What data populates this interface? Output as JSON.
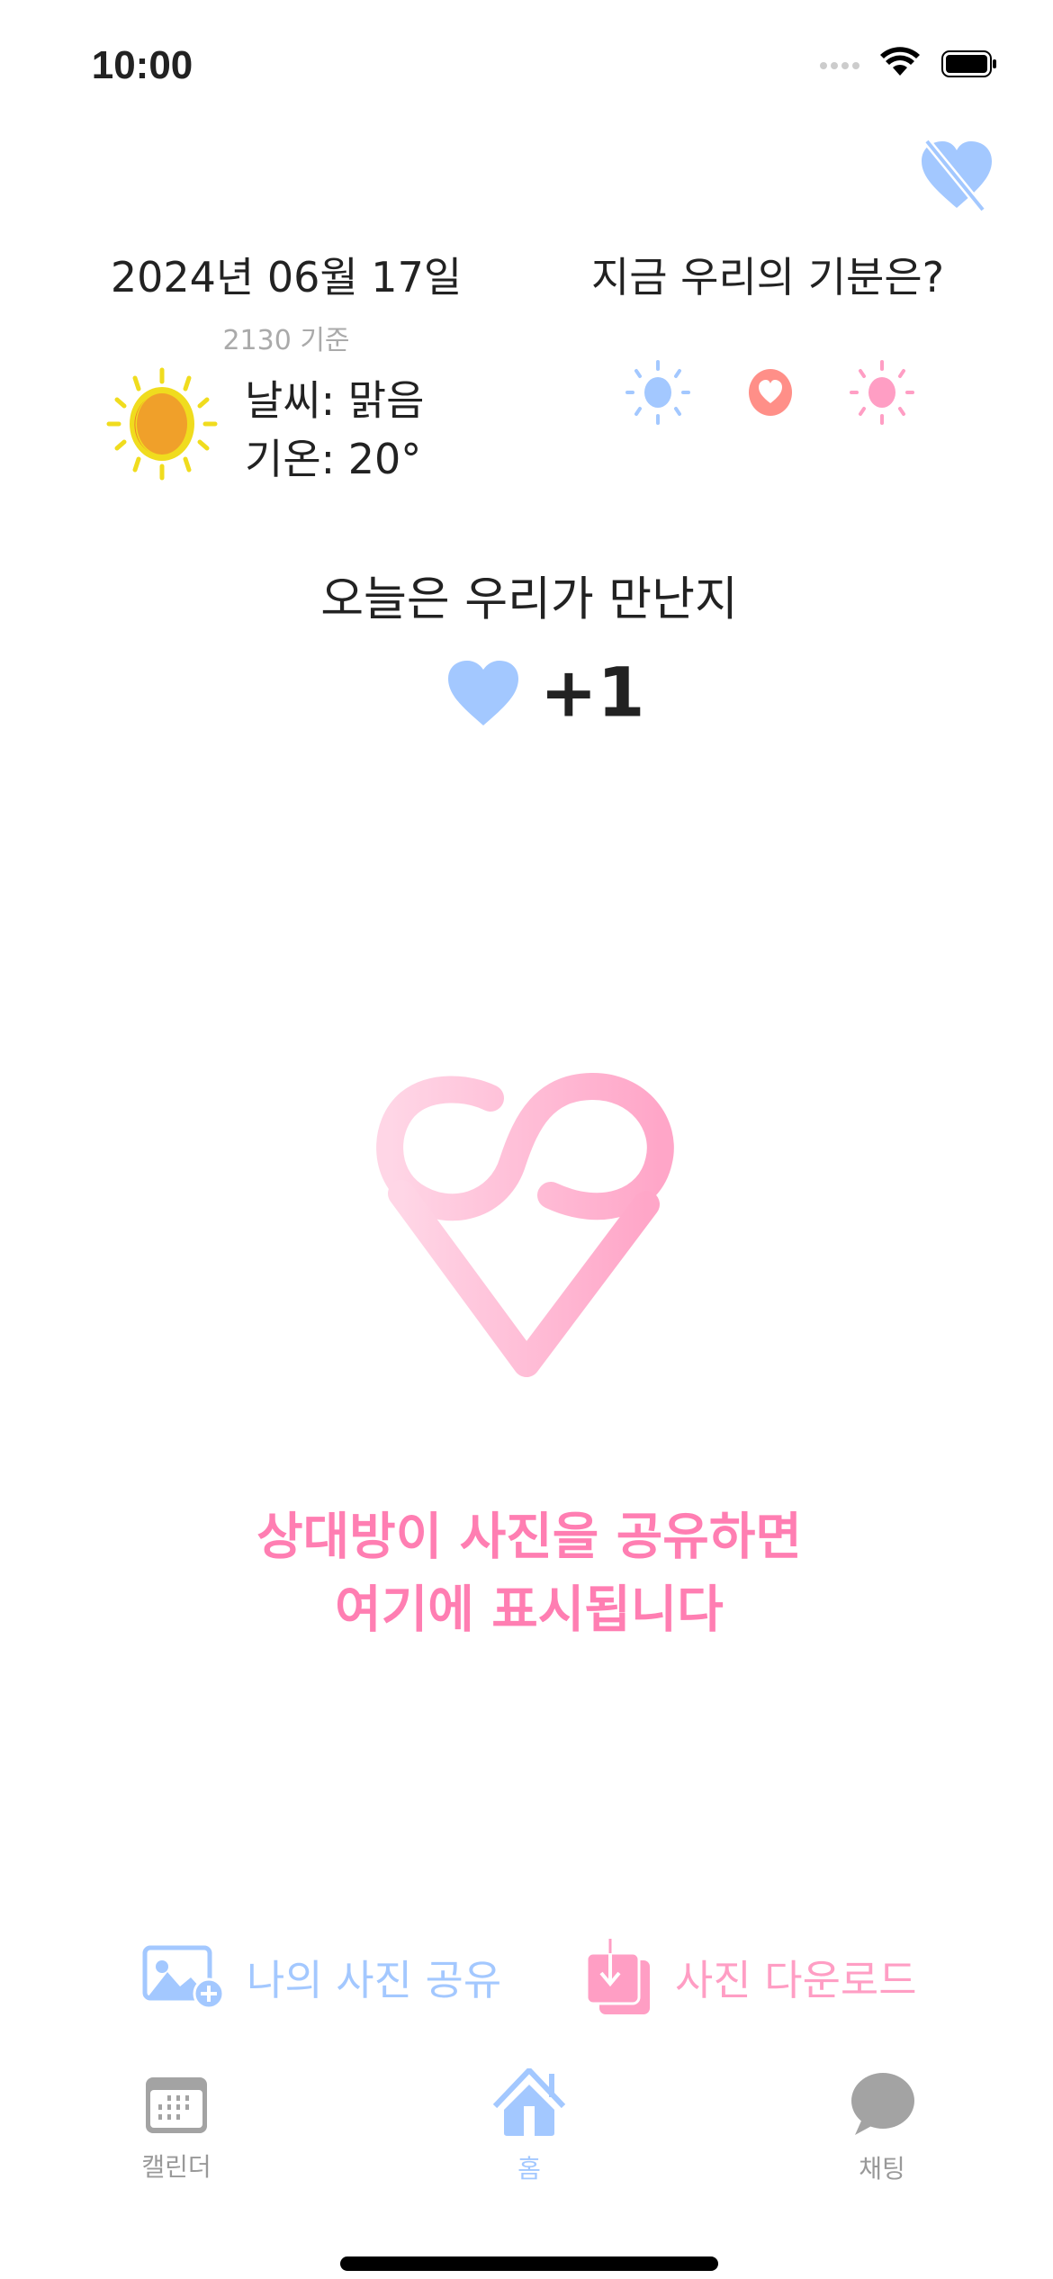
{
  "status_bar": {
    "time": "10:00"
  },
  "header": {
    "date": "2024년 06월 17일",
    "basis": "2130 기준",
    "weather": "날씨: 맑음",
    "temperature": "기온: 20°",
    "mood_question": "지금 우리의 기분은?"
  },
  "counter": {
    "title": "오늘은 우리가 만난지",
    "days": "+1"
  },
  "placeholder": {
    "line1": "상대방이 사진을 공유하면",
    "line2": "여기에 표시됩니다"
  },
  "actions": {
    "share": "나의 사진 공유",
    "download": "사진 다운로드"
  },
  "tabs": [
    {
      "label": "캘린더"
    },
    {
      "label": "홈"
    },
    {
      "label": "채팅"
    }
  ],
  "colors": {
    "blue": "#a3c8ff",
    "pink": "#ff9ec4",
    "text_pink": "#ff7eb2",
    "gray": "#a3a3a3"
  }
}
